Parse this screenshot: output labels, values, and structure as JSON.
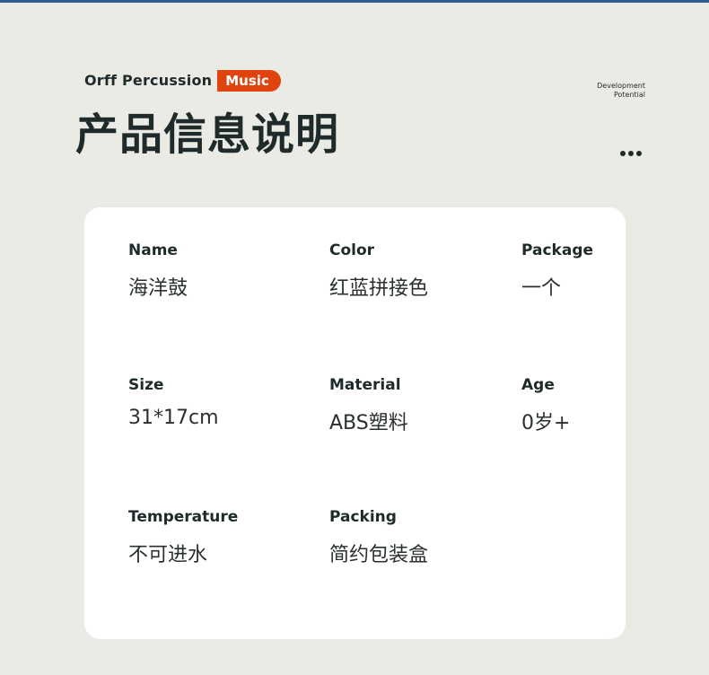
{
  "brand": {
    "name": "Orff Percussion",
    "badge": "Music"
  },
  "header": {
    "title": "产品信息说明",
    "note_line1": "Development",
    "note_line2": "Potential"
  },
  "specs": [
    {
      "label": "Name",
      "value": "海洋鼓"
    },
    {
      "label": "Color",
      "value": "红蓝拼接色"
    },
    {
      "label": "Package",
      "value": "一个"
    },
    {
      "label": "Size",
      "value": "31*17cm"
    },
    {
      "label": "Material",
      "value": "ABS塑料"
    },
    {
      "label": "Age",
      "value": "0岁+"
    },
    {
      "label": "Temperature",
      "value": "不可进水"
    },
    {
      "label": "Packing",
      "value": "简约包装盒"
    }
  ],
  "colors": {
    "accent": "#e0440e",
    "text": "#1f2a2a",
    "background": "#ebebe6",
    "card": "#ffffff"
  }
}
